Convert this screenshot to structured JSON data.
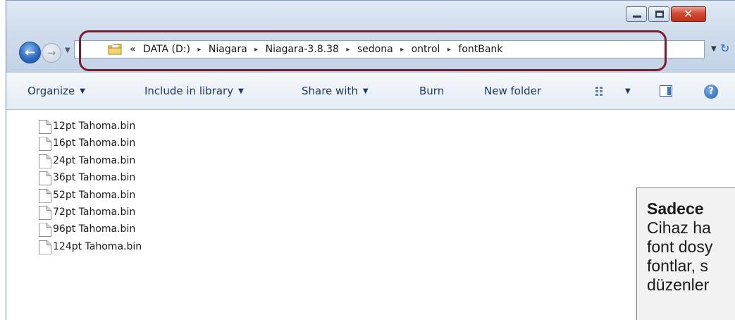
{
  "address": {
    "overflow_symbol": "«",
    "separator": "▸",
    "segments": [
      "DATA (D:)",
      "Niagara",
      "Niagara-3.8.38",
      "sedona",
      "ontrol",
      "fontBank"
    ]
  },
  "toolbar": {
    "organize": "Organize",
    "include_in_library": "Include in library",
    "share_with": "Share with",
    "burn": "Burn",
    "new_folder": "New folder"
  },
  "files": [
    "12pt Tahoma.bin",
    "16pt Tahoma.bin",
    "24pt Tahoma.bin",
    "36pt Tahoma.bin",
    "52pt Tahoma.bin",
    "72pt Tahoma.bin",
    "96pt Tahoma.bin",
    "124pt Tahoma.bin"
  ],
  "note": {
    "title": "Sadece",
    "lines": [
      "Cihaz ha",
      "font dosy",
      "fontlar, s",
      "düzenler"
    ]
  },
  "colors": {
    "highlight_border": "#7a1d2d",
    "close_button": "#c0301b",
    "toolbar_text": "#1e395b"
  },
  "icons": {
    "back": "back-arrow-icon",
    "forward": "forward-arrow-icon",
    "folder": "folder-icon",
    "file": "file-icon",
    "refresh": "refresh-icon",
    "help": "help-icon"
  }
}
